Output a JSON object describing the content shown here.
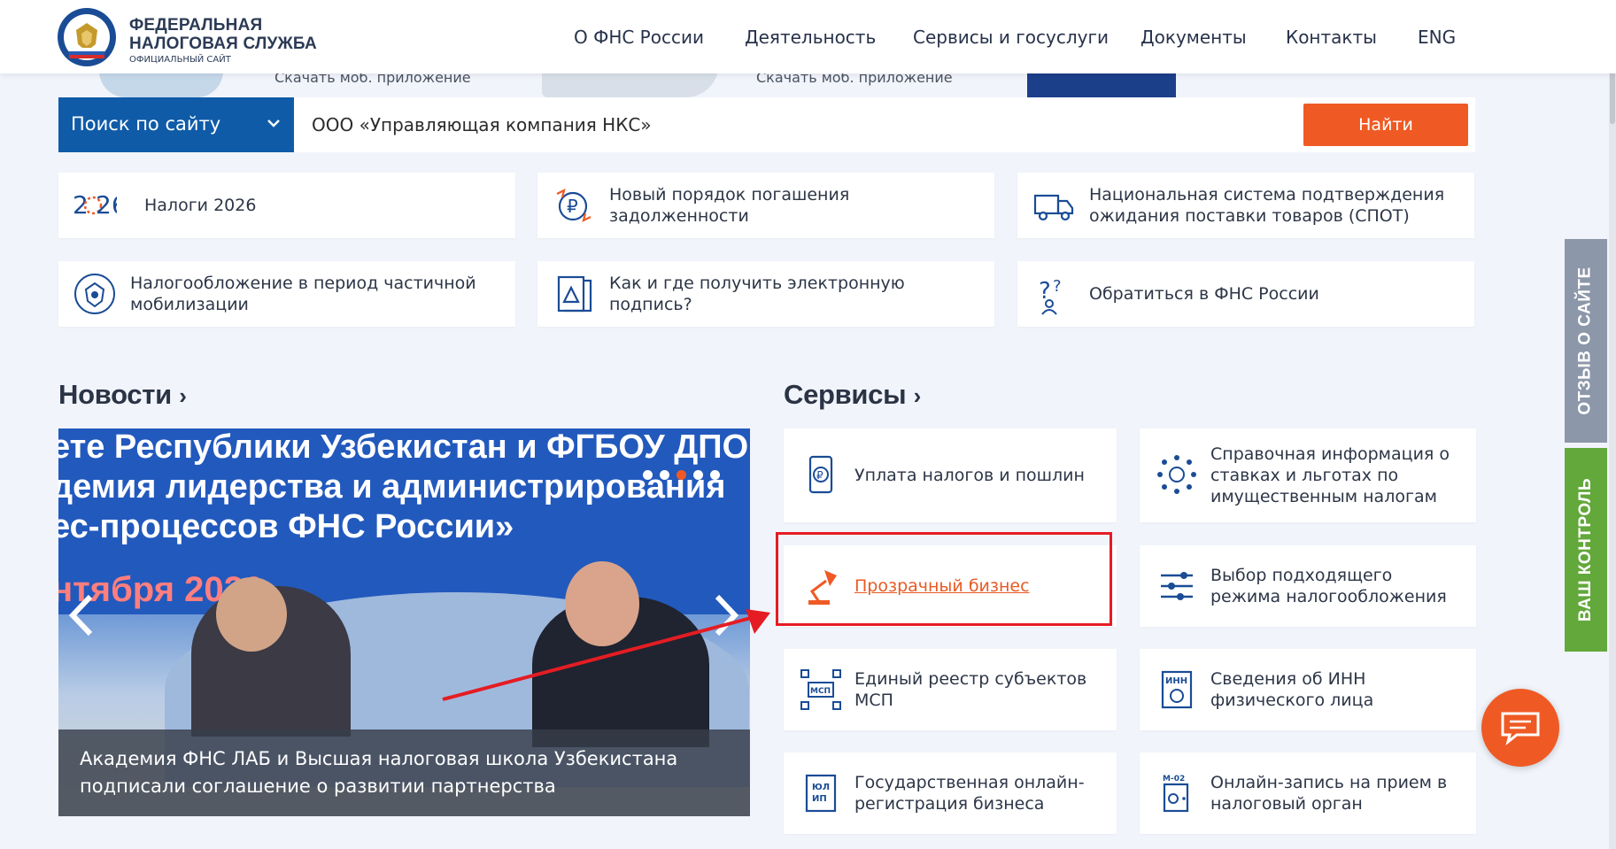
{
  "header": {
    "org_name_line1": "ФЕДЕРАЛЬНАЯ",
    "org_name_line2": "НАЛОГОВАЯ СЛУЖБА",
    "org_sub": "ОФИЦИАЛЬНЫЙ САЙТ",
    "nav": [
      "О ФНС России",
      "Деятельность",
      "Сервисы и госуслуги",
      "Документы",
      "Контакты",
      "ENG"
    ]
  },
  "promo": {
    "download_1": "Скачать моб. приложение",
    "download_2": "Скачать моб. приложение"
  },
  "search": {
    "scope_label": "Поиск по сайту",
    "query": "ООО «Управляющая компания НКС»",
    "button_label": "Найти"
  },
  "quick_links": [
    {
      "label": "Налоги 2026",
      "icon": "taxes-2026-icon"
    },
    {
      "label": "Новый порядок погашения задолженности",
      "icon": "ruble-cycle-icon"
    },
    {
      "label": "Национальная система подтверждения ожидания поставки товаров (СПОТ)",
      "icon": "truck-icon"
    },
    {
      "label": "Налогообложение в период частичной мобилизации",
      "icon": "emblem-icon"
    },
    {
      "label": "Как и где получить электронную подпись?",
      "icon": "e-signature-icon"
    },
    {
      "label": "Обратиться в ФНС России",
      "icon": "question-person-icon"
    }
  ],
  "news": {
    "title": "Новости",
    "banner_line1": "ете Республики Узбекистан и ФГБОУ ДПО",
    "banner_line2": "демия лидерства и администрирования",
    "banner_line3": "ес-процессов ФНС России»",
    "banner_date": "нтября 2026",
    "caption": "Академия ФНС ЛАБ и Высшая налоговая школа Узбекистана подписали соглашение о развитии партнерства",
    "slide_dots": 5,
    "active_dot": 2
  },
  "services": {
    "title": "Сервисы",
    "items": [
      {
        "label": "Уплата налогов и пошлин",
        "icon": "phone-ruble-icon"
      },
      {
        "label": "Справочная информация о ставках и льготах по имущественным налогам",
        "icon": "emblem-network-icon"
      },
      {
        "label": "Прозрачный бизнес",
        "icon": "desk-lamp-icon"
      },
      {
        "label": "Выбор подходящего режима налогообложения",
        "icon": "sliders-icon"
      },
      {
        "label": "Единый реестр субъектов МСП",
        "icon": "msp-network-icon"
      },
      {
        "label": "Сведения об ИНН физического лица",
        "icon": "inn-document-icon"
      },
      {
        "label": "Государственная онлайн-регистрация бизнеса",
        "icon": "ul-ip-document-icon"
      },
      {
        "label": "Онлайн-запись на прием в налоговый орган",
        "icon": "m02-door-icon"
      }
    ]
  },
  "side_tabs": {
    "feedback": "ОТЗЫВ О САЙТЕ",
    "control": "ВАШ КОНТРОЛЬ"
  },
  "colors": {
    "accent": "#ef5a24",
    "primary": "#0f5ba8",
    "highlight": "#e51c23",
    "feedback_tab": "#8c97a9",
    "control_tab": "#62a83a"
  }
}
